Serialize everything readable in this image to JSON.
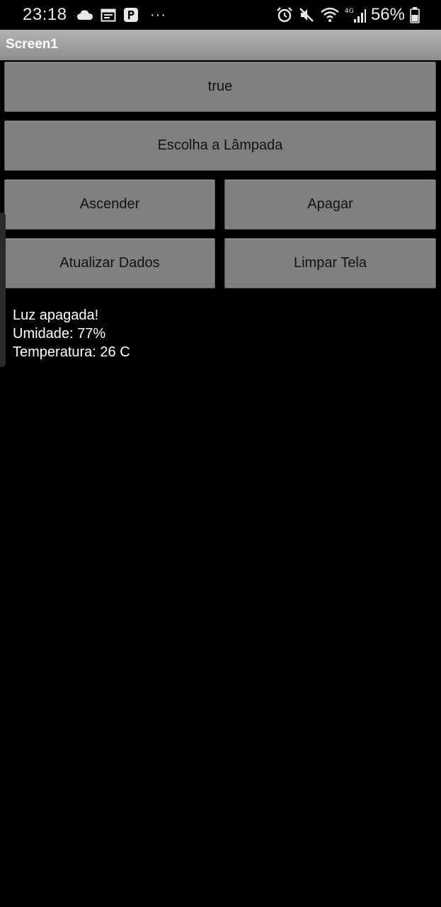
{
  "status_bar": {
    "time": "23:18",
    "more": "···",
    "battery_percent": "56%",
    "network_type": "4G",
    "icons_left": [
      "cloud-icon",
      "calendar-icon",
      "parking-app-icon"
    ],
    "icons_right": [
      "alarm-icon",
      "mute-icon",
      "wifi-icon",
      "signal-icon",
      "battery-icon"
    ]
  },
  "title_bar": {
    "title": "Screen1"
  },
  "buttons": {
    "status": "true",
    "choose_lamp": "Escolha a Lâmpada",
    "turn_on": "Ascender",
    "turn_off": "Apagar",
    "update_data": "Atualizar Dados",
    "clear_screen": "Limpar Tela"
  },
  "info": {
    "light": "Luz apagada!",
    "humidity": "Umidade: 77%",
    "temperature": "Temperatura: 26 C"
  },
  "colors": {
    "background": "#000000",
    "title_bar": "#a0a0a0",
    "button": "#808080",
    "text_light": "#ffffff",
    "text_dark": "#111111"
  }
}
